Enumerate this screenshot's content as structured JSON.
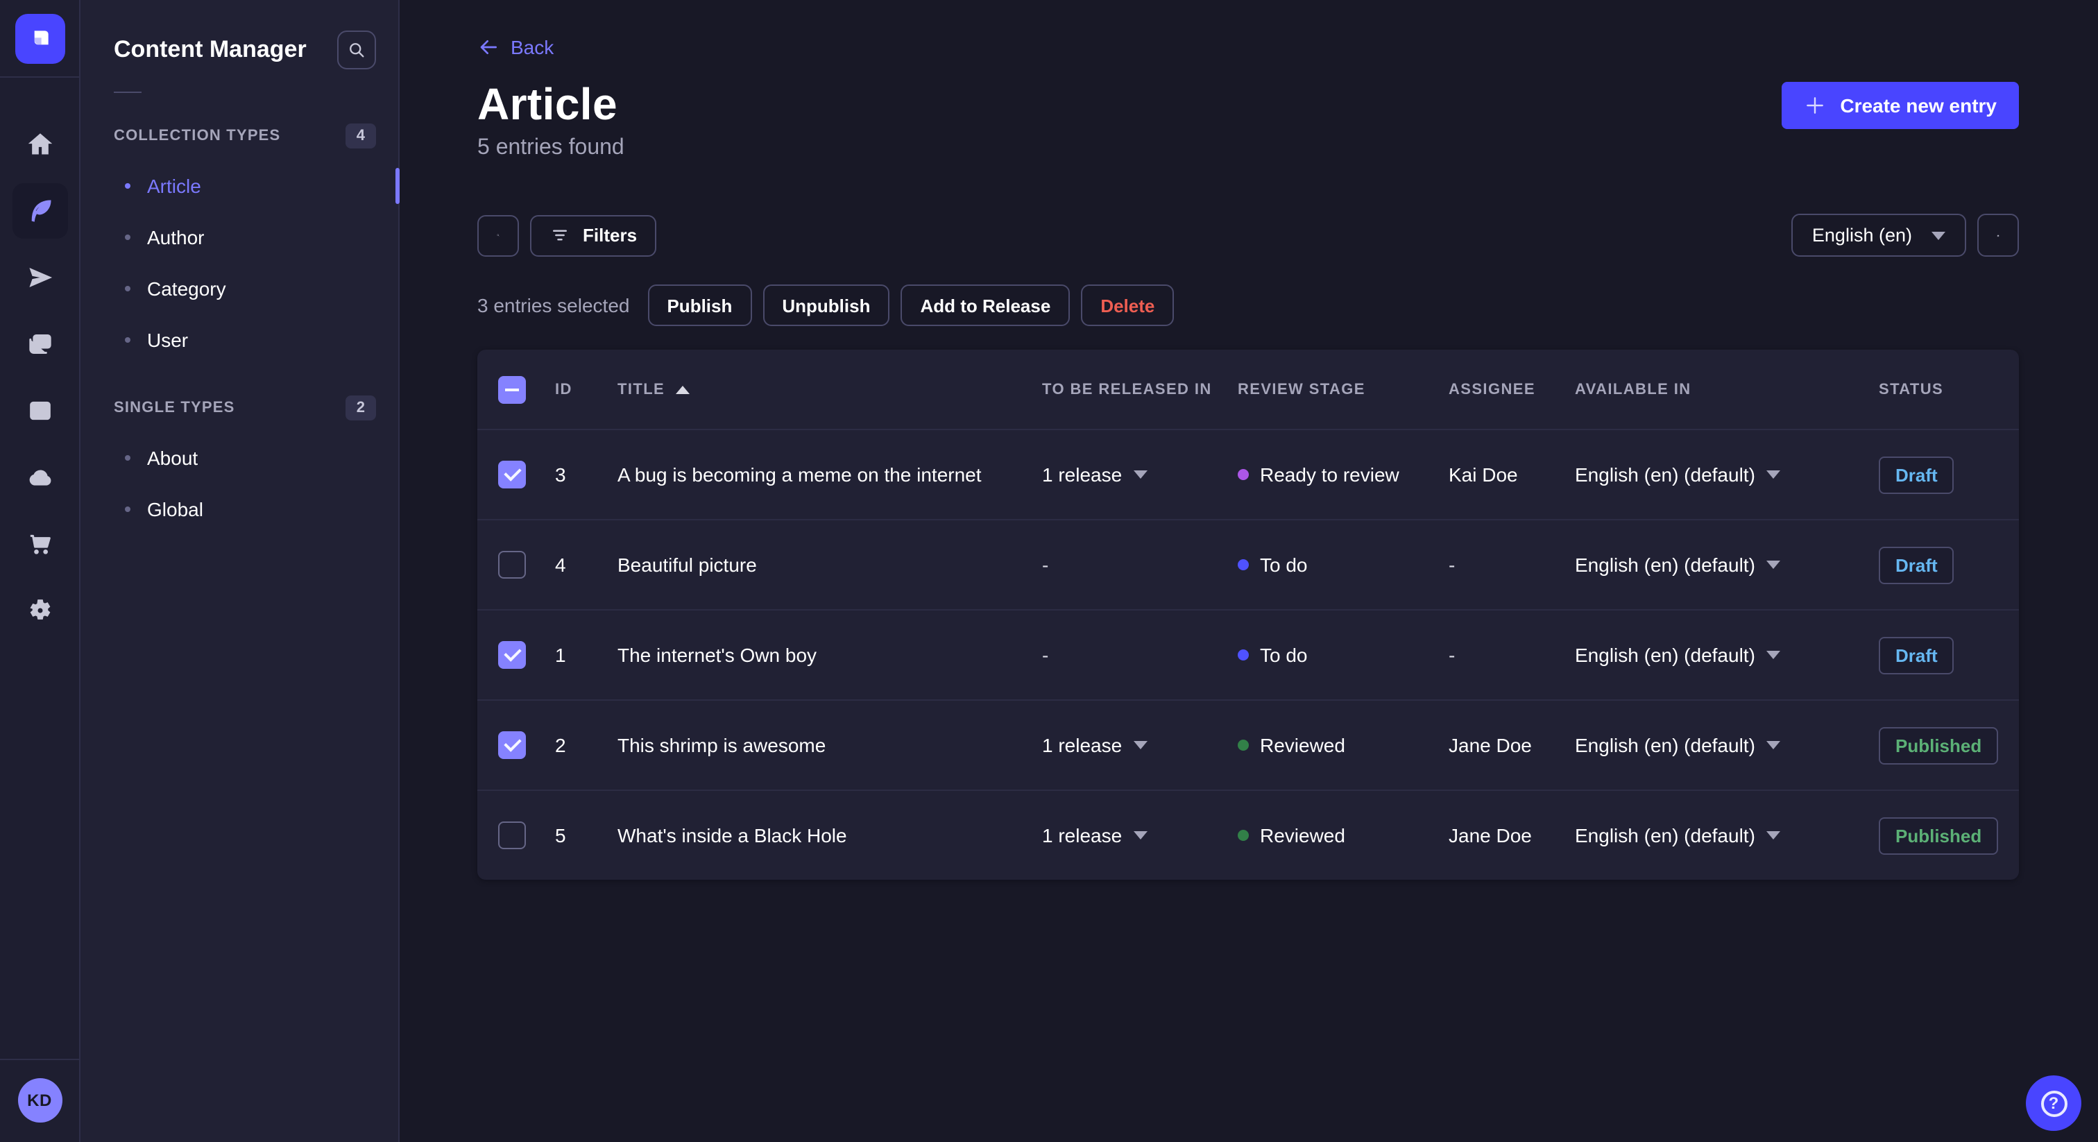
{
  "colors": {
    "accent": "#4945ff",
    "accent_light": "#7b79ff",
    "draft_text": "#66b7f1",
    "published_text": "#5cb176",
    "danger_text": "#ee5e52",
    "stage_ready_to_review": "#ac56e8",
    "stage_to_do": "#4f52ff",
    "stage_reviewed": "#328048"
  },
  "rail": {
    "avatar_initials": "KD"
  },
  "sidebar": {
    "title": "Content Manager",
    "sections": [
      {
        "label": "COLLECTION TYPES",
        "badge": "4",
        "items": [
          {
            "label": "Article",
            "active": true
          },
          {
            "label": "Author",
            "active": false
          },
          {
            "label": "Category",
            "active": false
          },
          {
            "label": "User",
            "active": false
          }
        ]
      },
      {
        "label": "SINGLE TYPES",
        "badge": "2",
        "items": [
          {
            "label": "About",
            "active": false
          },
          {
            "label": "Global",
            "active": false
          }
        ]
      }
    ]
  },
  "header": {
    "back_label": "Back",
    "title": "Article",
    "subtitle": "5 entries found",
    "create_label": "Create new entry"
  },
  "toolbar": {
    "filters_label": "Filters",
    "locale_value": "English (en)"
  },
  "selection": {
    "summary": "3 entries selected",
    "publish_label": "Publish",
    "unpublish_label": "Unpublish",
    "add_to_release_label": "Add to Release",
    "delete_label": "Delete"
  },
  "table": {
    "columns": {
      "id": "ID",
      "title": "TITLE",
      "release": "TO BE RELEASED IN",
      "stage": "REVIEW STAGE",
      "assignee": "ASSIGNEE",
      "available": "AVAILABLE IN",
      "status": "STATUS"
    },
    "rows": [
      {
        "checked": true,
        "id": "3",
        "title": "A bug is becoming a meme on the internet",
        "release": "1 release",
        "stage": "Ready to review",
        "stage_color": "#ac56e8",
        "assignee": "Kai Doe",
        "available": "English (en) (default)",
        "status": "Draft"
      },
      {
        "checked": false,
        "id": "4",
        "title": "Beautiful picture",
        "release": "-",
        "stage": "To do",
        "stage_color": "#4f52ff",
        "assignee": "-",
        "available": "English (en) (default)",
        "status": "Draft"
      },
      {
        "checked": true,
        "id": "1",
        "title": "The internet's Own boy",
        "release": "-",
        "stage": "To do",
        "stage_color": "#4f52ff",
        "assignee": "-",
        "available": "English (en) (default)",
        "status": "Draft"
      },
      {
        "checked": true,
        "id": "2",
        "title": "This shrimp is awesome",
        "release": "1 release",
        "stage": "Reviewed",
        "stage_color": "#328048",
        "assignee": "Jane Doe",
        "available": "English (en) (default)",
        "status": "Published"
      },
      {
        "checked": false,
        "id": "5",
        "title": "What's inside a Black Hole",
        "release": "1 release",
        "stage": "Reviewed",
        "stage_color": "#328048",
        "assignee": "Jane Doe",
        "available": "English (en) (default)",
        "status": "Published"
      }
    ]
  },
  "help": {
    "glyph": "?"
  }
}
